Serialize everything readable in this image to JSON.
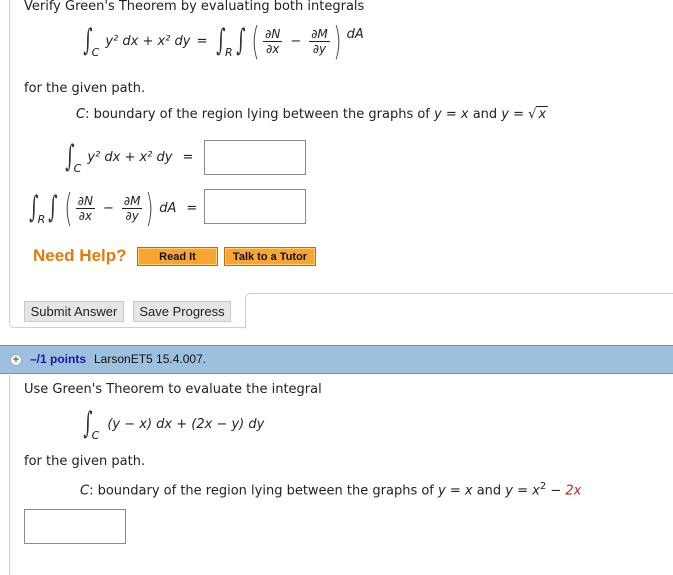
{
  "question1": {
    "intro": "Verify Green's Theorem by evaluating both integrals",
    "equation": {
      "line_integral_sub": "C",
      "line_integrand": "y² dx + x² dy",
      "equals": "=",
      "double_integral_sub": "R",
      "dN": "∂N",
      "dx": "∂x",
      "minus": "−",
      "dM": "∂M",
      "dy": "∂y",
      "dA": "dA"
    },
    "for_path": "for the given path.",
    "path_label": "C",
    "path_text": ": boundary of the region lying between the graphs of ",
    "graph1": "y = x",
    "and": " and ",
    "graph2_prefix": "y = ",
    "graph2_radicand": "x",
    "answers": [
      {
        "lhs_integrand": "y² dx + x² dy",
        "equals": "=",
        "value": ""
      },
      {
        "lhs": "double integral",
        "equals": "=",
        "value": ""
      }
    ],
    "need_help": "Need Help?",
    "help_buttons": [
      "Read It",
      "Talk to a Tutor"
    ],
    "submit_label": "Submit Answer",
    "save_label": "Save Progress"
  },
  "question2": {
    "header": {
      "icon": "plus-circle-icon",
      "points": "–/1 points",
      "id": "LarsonET5 15.4.007."
    },
    "intro": "Use Green's Theorem to evaluate the integral",
    "integral_sub": "C",
    "integrand": "(y − x) dx + (2x − y) dy",
    "for_path": "for the given path.",
    "path_label": "C",
    "path_text": ": boundary of the region lying between the graphs of ",
    "graph1": "y = x",
    "and": " and ",
    "graph2_prefix": "y = x",
    "graph2_exp": "2",
    "graph2_minus": " − ",
    "graph2_red": "2x",
    "answer_value": ""
  },
  "colors": {
    "accent_orange": "#e27b0c",
    "header_blue": "#9dc0df",
    "points_link": "#1a1aa0",
    "highlight_red": "#d21b1b"
  }
}
